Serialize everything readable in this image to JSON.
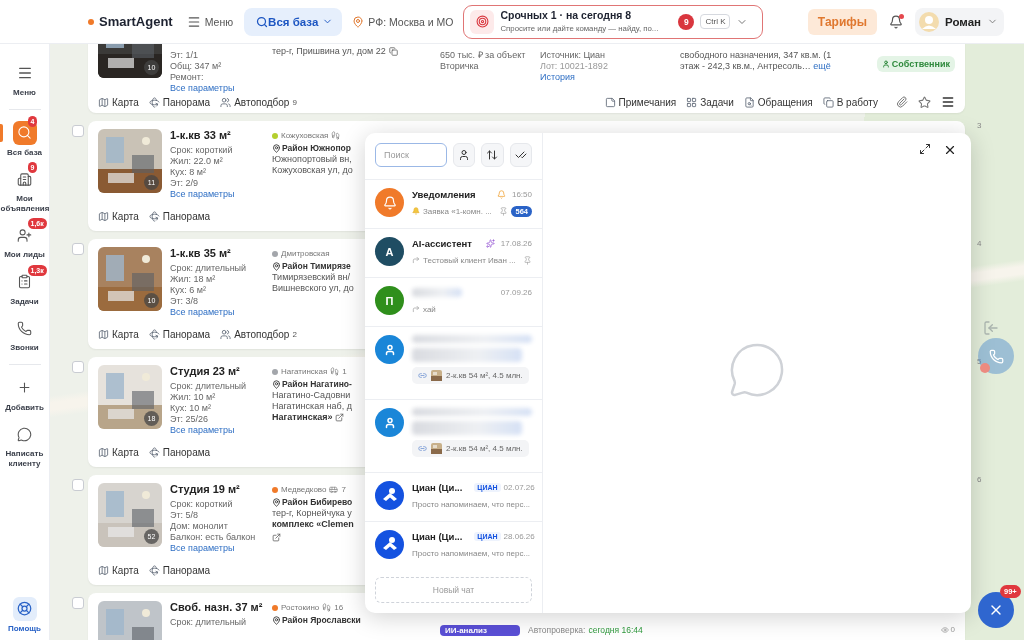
{
  "header": {
    "logo": "SmartAgent",
    "menu": "Меню",
    "base": "Вся база",
    "region": "РФ: Москва и МО",
    "command": {
      "title": "Срочных 1 · на сегодня 8",
      "placeholder": "Спросите или дайте команду — найду, по...",
      "count": "9",
      "shortcut": "Ctrl K"
    },
    "tariffs": "Тарифы",
    "notifications_unread": true,
    "user": "Роман"
  },
  "sidebar": {
    "menu": "Меню",
    "items": [
      {
        "kind": "search",
        "label": "Вся база",
        "badge": "4",
        "selected": true
      },
      {
        "kind": "building",
        "label": "Мои объявления",
        "badge": "9",
        "selected": false
      },
      {
        "kind": "leads",
        "label": "Мои лиды",
        "badge": "1,6к",
        "selected": false
      },
      {
        "kind": "tasks",
        "label": "Задачи",
        "badge": "1,3к",
        "selected": false
      },
      {
        "kind": "calls",
        "label": "Звонки",
        "selected": false
      }
    ],
    "actions": [
      {
        "kind": "add",
        "label": "Добавить"
      },
      {
        "kind": "message",
        "label": "Написать клиенту"
      }
    ],
    "help": "Помощь"
  },
  "top_listing": {
    "params": [
      "Эт: 1/1",
      "Общ: 347 м²",
      "Ремонт:"
    ],
    "params_link": "Все параметры",
    "photos": "10",
    "address": "тер-г, Пришвина ул, дом 22",
    "price": "650 тыс. ₽ за объект",
    "market": "Вторичка",
    "source": "Источник: Циан",
    "lot": "Лот: 10021-1892",
    "history": "История",
    "description": "свободного назначения, 347 кв.м. (1 этаж - 242,3 кв.м., Антресоль…",
    "more": "ещё",
    "owner": "Собственник",
    "actions": [
      {
        "kind": "map",
        "label": "Карта"
      },
      {
        "kind": "panorama",
        "label": "Панорама"
      },
      {
        "kind": "match",
        "label": "Автоподбор",
        "count": "9"
      }
    ],
    "tools": [
      {
        "kind": "notes",
        "label": "Примечания"
      },
      {
        "kind": "tasks",
        "label": "Задачи"
      },
      {
        "kind": "requests",
        "label": "Обращения"
      },
      {
        "kind": "work",
        "label": "В работу"
      }
    ]
  },
  "listings": [
    {
      "checked": false,
      "number": "3",
      "title": "1-к.кв 33 м²",
      "params": [
        "Срок: короткий",
        "Жил: 22.0 м²",
        "Кух: 8 м²",
        "Эт: 2/9"
      ],
      "params_link": "Все параметры",
      "photos": "11",
      "metro": {
        "name": "Кожуховская",
        "color": "#b4cf2e",
        "kind": "walk"
      },
      "district": "Район Южнопор",
      "address": [
        "Южнопортовый вн,",
        "Кожуховская ул, до"
      ],
      "actions": [
        {
          "kind": "map",
          "label": "Карта"
        },
        {
          "kind": "panorama",
          "label": "Панорама"
        }
      ]
    },
    {
      "checked": false,
      "number": "4",
      "title": "1-к.кв 35 м²",
      "params": [
        "Срок: длительный",
        "Жил: 18 м²",
        "Кух: 6 м²",
        "Эт: 3/8"
      ],
      "params_link": "Все параметры",
      "photos": "10",
      "metro": {
        "name": "Дмитровская",
        "color": "#a3a6ab"
      },
      "district": "Район Тимирязе",
      "address": [
        "Тимирязевский вн/",
        "Вишневского ул, до"
      ],
      "actions": [
        {
          "kind": "map",
          "label": "Карта"
        },
        {
          "kind": "panorama",
          "label": "Панорама"
        },
        {
          "kind": "match",
          "label": "Автоподбор",
          "count": "2"
        }
      ]
    },
    {
      "checked": false,
      "number": "5",
      "title": "Студия 23 м²",
      "params": [
        "Срок: длительный",
        "Жил: 10 м²",
        "Кух: 10 м²",
        "Эт: 25/26"
      ],
      "params_link": "Все параметры",
      "photos": "18",
      "metro": {
        "name": "Нагатинская",
        "color": "#a3a6ab",
        "kind": "walk",
        "minutes": "1"
      },
      "district": "Район Нагатино-",
      "address": [
        "Нагатино-Садовни",
        "Нагатинская наб, д"
      ],
      "complex": "Нагатинская»",
      "actions": [
        {
          "kind": "map",
          "label": "Карта"
        },
        {
          "kind": "panorama",
          "label": "Панорама"
        }
      ]
    },
    {
      "checked": false,
      "number": "6",
      "title": "Студия 19 м²",
      "params": [
        "Срок: короткий",
        "Эт: 5/8",
        "Дом: монолит",
        "Балкон: есть балкон"
      ],
      "params_link": "Все параметры",
      "photos": "52",
      "metro": {
        "name": "Медведково",
        "color": "#f07a2a",
        "kind": "bus",
        "minutes": "7"
      },
      "district": "Район Бибирево",
      "address": [
        "тер-г, Корнейчука у"
      ],
      "complex": "комплекс «Clemen",
      "actions": [
        {
          "kind": "map",
          "label": "Карта"
        },
        {
          "kind": "panorama",
          "label": "Панорама"
        }
      ]
    },
    {
      "checked": false,
      "title": "Своб. назн. 37 м²",
      "params": [
        "Срок: длительный"
      ],
      "metro": {
        "name": "Ростокино",
        "color": "#f07a2a",
        "kind": "walk",
        "minutes": "16"
      },
      "district": "Район Ярославски",
      "ai_badge": "ИИ-анализ",
      "autocheck": "Автопроверка:",
      "autocheck_value": "сегодня 16:44",
      "views": "0"
    }
  ],
  "chat": {
    "search_placeholder": "Поиск",
    "new_chat": "Новый чат",
    "items": [
      {
        "kind": "notifications",
        "color": "#f07a2a",
        "name": "Уведомления",
        "time": "16:50",
        "preview": "Заявка «1-комн. ...",
        "pinned": true,
        "unread": "564"
      },
      {
        "kind": "ai",
        "color": "#1f4d63",
        "initial": "А",
        "name": "AI-ассистент",
        "time": "17.08.26",
        "preview": "Тестовый клиент Иван ...",
        "pinned": true
      },
      {
        "kind": "contact",
        "color": "#2f8f1c",
        "initial": "П",
        "time": "07.09.26",
        "preview": "хай",
        "pinned": false
      },
      {
        "kind": "listing",
        "color": "#1a86d8",
        "listing": "2-к.кв 54 м², 4.5 млн.",
        "pinned": false
      },
      {
        "kind": "listing",
        "color": "#1a86d8",
        "listing": "2-к.кв 54 м², 4.5 млн.",
        "pinned": false
      },
      {
        "kind": "cian",
        "color": "#1452e0",
        "name": "Циан (Ци...",
        "tag": "ЦИАН",
        "time": "02.07.26",
        "preview": "Просто напоминаем, что перс...",
        "pinned": false
      },
      {
        "kind": "cian",
        "color": "#1452e0",
        "name": "Циан (Ци...",
        "tag": "ЦИАН",
        "time": "28.06.26",
        "preview": "Просто напоминаем, что перс...",
        "pinned": false
      }
    ]
  },
  "floating": {
    "count": "99+",
    "missed_call": true
  }
}
